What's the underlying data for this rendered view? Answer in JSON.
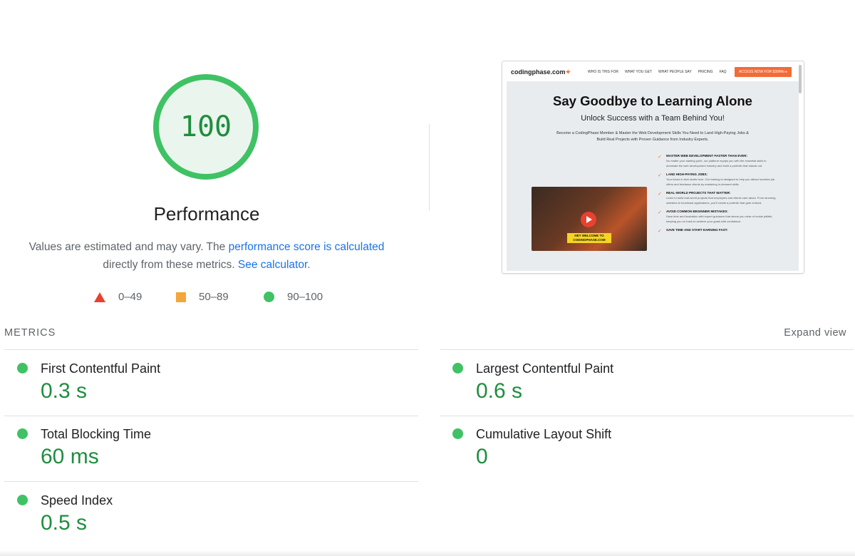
{
  "score": {
    "value": "100",
    "label": "Performance",
    "fraction": 1.0,
    "color": "#3fc264"
  },
  "description": {
    "before": "Values are estimated and may vary. The ",
    "link1": "performance score is calculated",
    "middle": " directly from these metrics. ",
    "link2": "See calculator."
  },
  "legend": {
    "fail": "0–49",
    "average": "50–89",
    "pass": "90–100"
  },
  "thumbnail": {
    "logo": "codingphase.com",
    "logo_mark": "✦",
    "nav_links": [
      "WHO IS THIS FOR",
      "WHAT YOU GET",
      "WHAT PEOPLE SAY",
      "PRICING",
      "FAQ"
    ],
    "cta": "ACCESS NOW FOR $39/Mo ▸",
    "headline": "Say Goodbye to Learning Alone",
    "subheadline": "Unlock Success with a Team Behind You!",
    "paragraph": "Become a CodingPhase Member & Master the Web Development Skills You Need to Land High-Paying Jobs & Build Real Projects with Proven Guidance from Industry Experts.",
    "video_caption": "HEY WELCOME TO CODINGPHASE.COM",
    "features": [
      {
        "title": "MASTER WEB DEVELOPMENT FASTER THAN EVER:",
        "desc": "No matter your starting point, our platform equips you with the essential skills to dominate the web development industry and build a portfolio that stands out."
      },
      {
        "title": "LAND HIGH-PAYING JOBS:",
        "desc": "Your future in tech starts here. Our training is designed to help you attract lucrative job offers and freelance clients by mastering in-demand skills."
      },
      {
        "title": "REAL-WORLD PROJECTS THAT MATTER:",
        "desc": "Learn to build real-world projects that employers and clients care about. From stunning websites to functional applications, you'll create a portfolio that gets noticed."
      },
      {
        "title": "AVOID COMMON BEGINNER MISTAKES:",
        "desc": "Save time and frustration with expert guidance that steers you clear of rookie pitfalls, keeping you on track to achieve your goals with confidence."
      },
      {
        "title": "SAVE TIME AND START EARNING FAST:",
        "desc": ""
      }
    ]
  },
  "metrics": {
    "title": "METRICS",
    "expand": "Expand view",
    "items": [
      {
        "label": "First Contentful Paint",
        "value": "0.3 s"
      },
      {
        "label": "Largest Contentful Paint",
        "value": "0.6 s"
      },
      {
        "label": "Total Blocking Time",
        "value": "60 ms"
      },
      {
        "label": "Cumulative Layout Shift",
        "value": "0"
      },
      {
        "label": "Speed Index",
        "value": "0.5 s"
      }
    ]
  },
  "colors": {
    "pass": "#3fc264",
    "pass_text": "#1e8e3e",
    "average": "#f4a63a",
    "fail": "#e8412f",
    "link": "#1a73e8",
    "cta": "#f26b38"
  }
}
